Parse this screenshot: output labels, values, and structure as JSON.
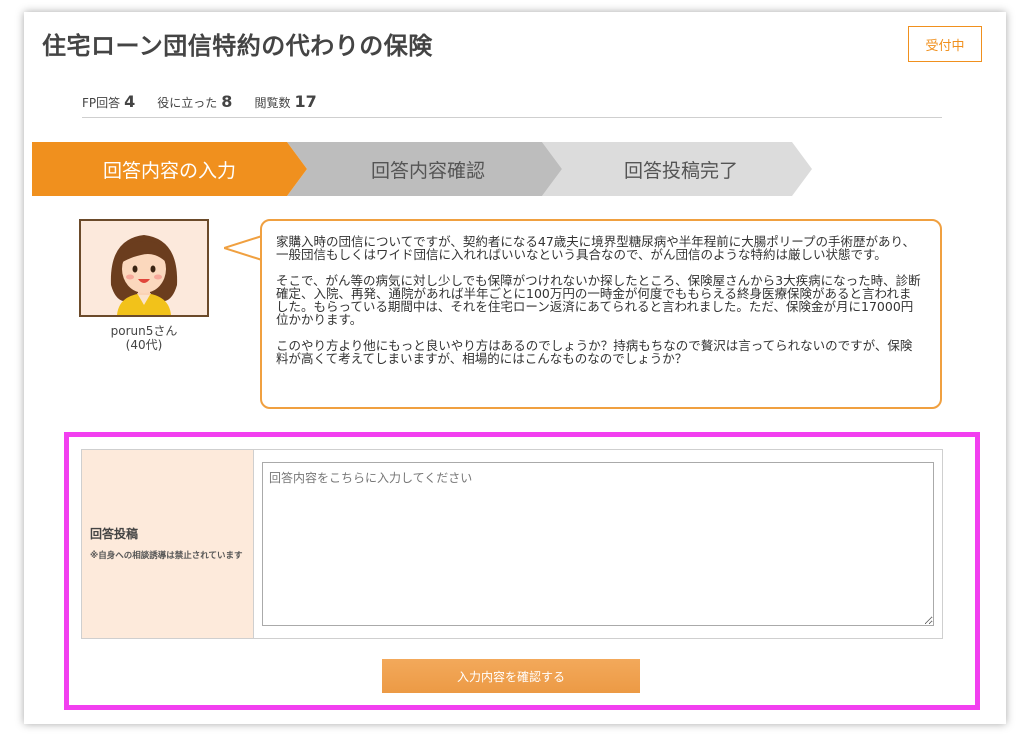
{
  "header": {
    "title": "住宅ローン団信特約の代わりの保険",
    "status_badge": "受付中"
  },
  "stats": {
    "fp_answers_label": "FP回答",
    "fp_answers_count": "4",
    "helpful_label": "役に立った",
    "helpful_count": "8",
    "views_label": "閲覧数",
    "views_count": "17"
  },
  "steps": [
    {
      "label": "回答内容の入力",
      "active": true
    },
    {
      "label": "回答内容確認",
      "active": false
    },
    {
      "label": "回答投稿完了",
      "active": false
    }
  ],
  "colors": {
    "accent": "#f0901e",
    "step_active": "#f0901e",
    "step_inactive_1": "#bdbdbd",
    "step_inactive_2": "#dcdcdc",
    "highlight_border": "#f23ff0",
    "label_bg": "#fdeadb"
  },
  "question": {
    "user_name": "porun5さん",
    "user_age": "(40代)",
    "paragraphs": [
      "家購入時の団信についてですが、契約者になる47歳夫に境界型糖尿病や半年程前に大腸ポリープの手術歴があり、一般団信もしくはワイド団信に入れればいいなという具合なので、がん団信のような特約は厳しい状態です。",
      "そこで、がん等の病気に対し少しでも保障がつけれないか探したところ、保険屋さんから3大疾病になった時、診断確定、入院、再発、通院があれば半年ごとに100万円の一時金が何度でももらえる終身医療保険があると言われました。もらっている期間中は、それを住宅ローン返済にあてられると言われました。ただ、保険金が月に17000円位かかります。",
      "このやり方より他にもっと良いやり方はあるのでしょうか？持病もちなので贅沢は言ってられないのですが、保険料が高くて考えてしまいますが、相場的にはこんなものなのでしょうか？"
    ]
  },
  "form": {
    "label": "回答投稿",
    "note": "※自身への相談誘導は禁止されています",
    "placeholder": "回答内容をこちらに入力してください",
    "value": "",
    "confirm_label": "入力内容を確認する"
  }
}
